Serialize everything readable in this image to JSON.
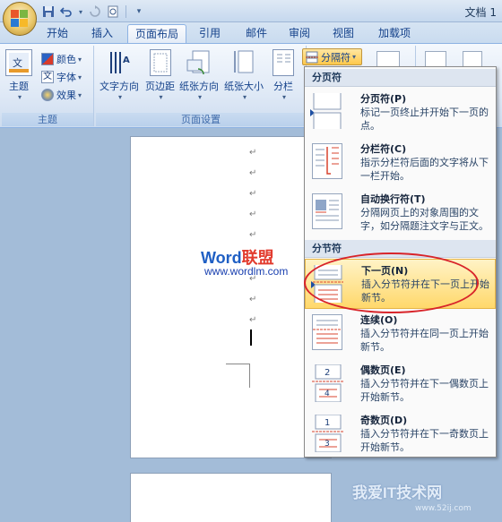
{
  "titlebar": {
    "title": "文档 1",
    "qat_icons": [
      "save-icon",
      "undo-icon",
      "redo-icon",
      "print-preview-icon"
    ]
  },
  "tabs": [
    {
      "label": "开始",
      "active": false
    },
    {
      "label": "插入",
      "active": false
    },
    {
      "label": "页面布局",
      "active": true
    },
    {
      "label": "引用",
      "active": false
    },
    {
      "label": "邮件",
      "active": false
    },
    {
      "label": "审阅",
      "active": false
    },
    {
      "label": "视图",
      "active": false
    },
    {
      "label": "加载项",
      "active": false
    }
  ],
  "ribbon": {
    "theme_group": {
      "label": "主题",
      "theme_button": "主题",
      "colors": "颜色",
      "fonts": "字体",
      "effects": "效果"
    },
    "page_setup_group": {
      "label": "页面设置",
      "text_direction": "文字方向",
      "margins": "页边距",
      "orientation": "纸张方向",
      "size": "纸张大小",
      "columns": "分栏",
      "breaks": "分隔符"
    }
  },
  "document": {
    "watermark_word": "Word",
    "watermark_lianmeng": "联盟",
    "watermark_url": "www.wordlm.com",
    "paragraph_mark": "↵"
  },
  "breaks_menu": {
    "page_breaks_header": "分页符",
    "section_breaks_header": "分节符",
    "items": [
      {
        "title": "分页符(P)",
        "desc": "标记一页终止并开始下一页的点。"
      },
      {
        "title": "分栏符(C)",
        "desc": "指示分栏符后面的文字将从下一栏开始。"
      },
      {
        "title": "自动换行符(T)",
        "desc": "分隔网页上的对象周围的文字，如分隔题注文字与正文。"
      },
      {
        "title": "下一页(N)",
        "desc": "插入分节符并在下一页上开始新节。"
      },
      {
        "title": "连续(O)",
        "desc": "插入分节符并在同一页上开始新节。"
      },
      {
        "title": "偶数页(E)",
        "desc": "插入分节符并在下一偶数页上开始新节。"
      },
      {
        "title": "奇数页(D)",
        "desc": "插入分节符并在下一奇数页上开始新节。"
      }
    ],
    "even_page_number": "2",
    "even_page_number2": "4",
    "odd_page_number": "1",
    "odd_page_number2": "3"
  },
  "site_watermark": {
    "text": "我爱IT技术网",
    "url": "www.52ij.com"
  },
  "colors": {
    "ribbon_text": "#15428b",
    "highlight": "#ffd86b",
    "annotation_red": "#d8242a",
    "section_line_red": "#d8442f"
  }
}
